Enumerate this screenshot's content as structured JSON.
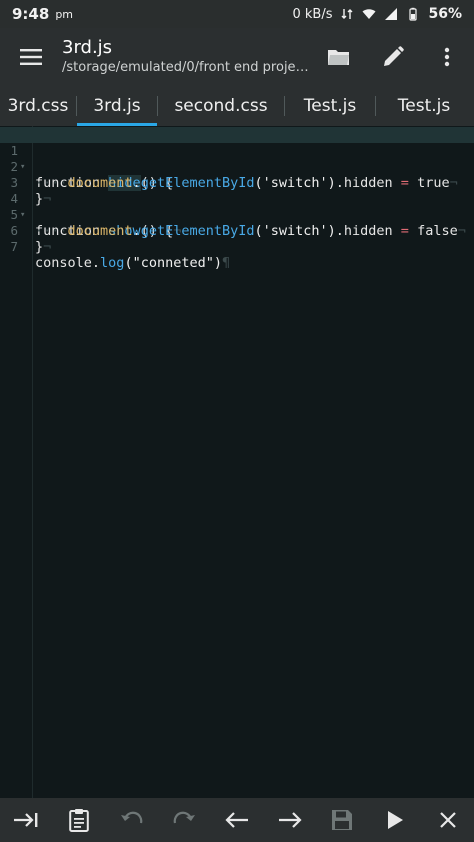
{
  "statusbar": {
    "time": "9:48",
    "ampm": "pm",
    "net_speed": "0 kB/s",
    "battery": "56%"
  },
  "appbar": {
    "title": "3rd.js",
    "subtitle": "/storage/emulated/0/front end project..."
  },
  "tabs": [
    {
      "label": "3rd.css"
    },
    {
      "label": "3rd.js"
    },
    {
      "label": "second.css"
    },
    {
      "label": "Test.js"
    },
    {
      "label": "Test.js"
    }
  ],
  "editor": {
    "line_numbers": [
      "1",
      "2",
      "3",
      "4",
      "5",
      "6",
      "7"
    ],
    "line1": {
      "kw": "function ",
      "fn": "hide",
      "rest": "() {"
    },
    "line2": {
      "ws": "····",
      "obj": "document",
      "dot": ".",
      "method": "getElementById",
      "arg": "('switch')",
      "prop": ".hidden",
      "op": " = ",
      "val": "true",
      "eol": "¬"
    },
    "line3": {
      "text": "}",
      "eol": "¬"
    },
    "line4": {
      "kw": "function ",
      "fn": "show",
      "rest": "() {",
      "eol": "¬"
    },
    "line5": {
      "ws": "····",
      "obj": "document",
      "dot": ".",
      "method": "getElementById",
      "arg": "('switch')",
      "prop": ".hidden",
      "op": " = ",
      "val": "false",
      "eol": "¬"
    },
    "line6": {
      "text": "}",
      "eol": "¬"
    },
    "line7": {
      "obj": "console",
      "dot": ".",
      "method": "log",
      "arg": "(\"conneted\")",
      "eol": "¶"
    }
  },
  "colors": {
    "accent": "#2aa7e6",
    "background": "#10181a",
    "bar": "#2b2f30"
  }
}
